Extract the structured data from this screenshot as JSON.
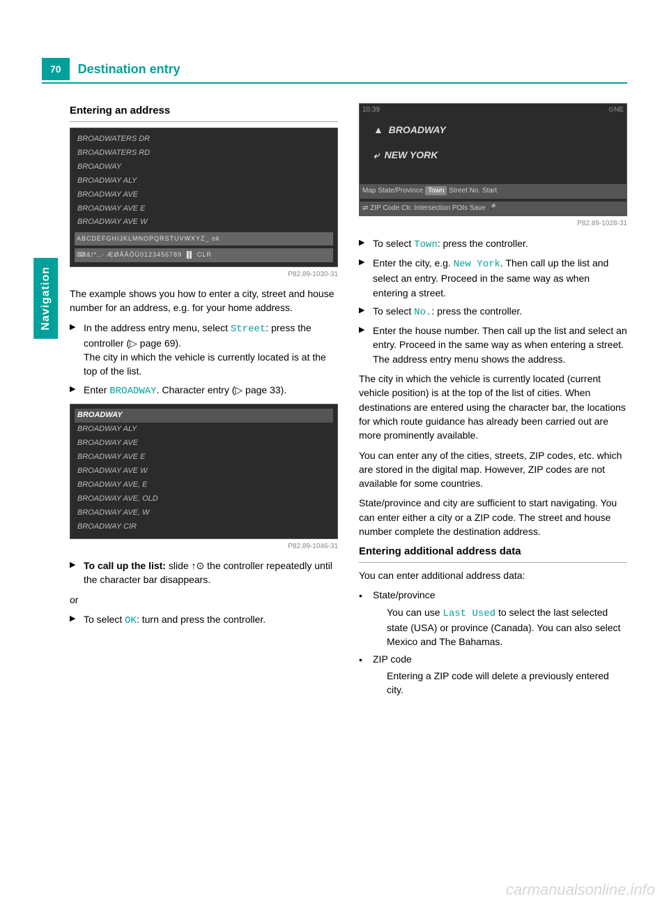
{
  "page_number": "70",
  "page_title": "Destination entry",
  "sidebar_tab": "Navigation",
  "col1": {
    "h1": "Entering an address",
    "img1": {
      "rows": [
        "BROADWATERS DR",
        "BROADWATERS RD",
        "BROADWAY",
        "BROADWAY ALY",
        "BROADWAY AVE",
        "BROADWAY AVE E",
        "BROADWAY AVE W"
      ],
      "keyboard1": "ABCDEFGHIJKLMNOPQRSTUVWXYZ_ ok",
      "keyboard2": "⌨&!*,.-  ÆØÅÄÖÜ0123456789 ▐▌ CLR",
      "caption": "P82.89-1030-31"
    },
    "p1": "The example shows you how to enter a city, street and house number for an address, e.g. for your home address.",
    "step1a": "In the address entry menu, select ",
    "step1_code": "Street",
    "step1b": ": press the controller (▷ page 69).",
    "step1c": "The city in which the vehicle is currently located is at the top of the list.",
    "step2a": "Enter ",
    "step2_code": "BROADWAY",
    "step2b": ". Character entry (▷ page 33).",
    "img2": {
      "rows": [
        "BROADWAY",
        "BROADWAY ALY",
        "BROADWAY AVE",
        "BROADWAY AVE E",
        "BROADWAY AVE W",
        "BROADWAY AVE, E",
        "BROADWAY AVE, OLD",
        "BROADWAY AVE, W",
        "BROADWAY CIR"
      ],
      "caption": "P82.89-1046-31"
    },
    "step3_bold": "To call up the list:",
    "step3_rest": " slide ↑⊙ the controller repeatedly until the character bar disappears.",
    "or": "or",
    "step4a": "To select ",
    "step4_code": "OK",
    "step4b": ": turn and press the controller."
  },
  "col2": {
    "img3": {
      "time": "10:39",
      "compass": "⊙NE",
      "line1": "BROADWAY",
      "line2": "NEW YORK",
      "menubar1": [
        "Map",
        "State/Province",
        "Town",
        "Street",
        "No.",
        "Start"
      ],
      "menubar2": [
        "⇄",
        "ZIP Code",
        "Ctr.",
        "Intersection",
        "POIs",
        "Save",
        "🎤"
      ],
      "caption": "P82.89-1028-31"
    },
    "step5a": "To select ",
    "step5_code": "Town",
    "step5b": ": press the controller.",
    "step6a": "Enter the city, e.g. ",
    "step6_code": "New York",
    "step6b": ". Then call up the list and select an entry. Proceed in the same way as when entering a street.",
    "step7a": "To select ",
    "step7_code": "No.",
    "step7b": ": press the controller.",
    "step8a": "Enter the house number. Then call up the list and select an entry. Proceed in the same way as when entering a street.",
    "step8b": "The address entry menu shows the address.",
    "p2": "The city in which the vehicle is currently located (current vehicle position) is at the top of the list of cities. When destinations are entered using the character bar, the locations for which route guidance has already been carried out are more prominently available.",
    "p3": "You can enter any of the cities, streets, ZIP codes, etc. which are stored in the digital map. However, ZIP codes are not available for some countries.",
    "p4": "State/province and city are sufficient to start navigating. You can enter either a city or a ZIP code. The street and house number complete the destination address.",
    "h2": "Entering additional address data",
    "p5": "You can enter additional address data:",
    "bullet1_label": "State/province",
    "bullet1a": "You can use ",
    "bullet1_code": "Last Used",
    "bullet1b": " to select the last selected state (USA) or province (Canada). You can also select Mexico and The Bahamas.",
    "bullet2_label": "ZIP code",
    "bullet2_text": "Entering a ZIP code will delete a previously entered city."
  },
  "watermark": "carmanualsonline.info"
}
